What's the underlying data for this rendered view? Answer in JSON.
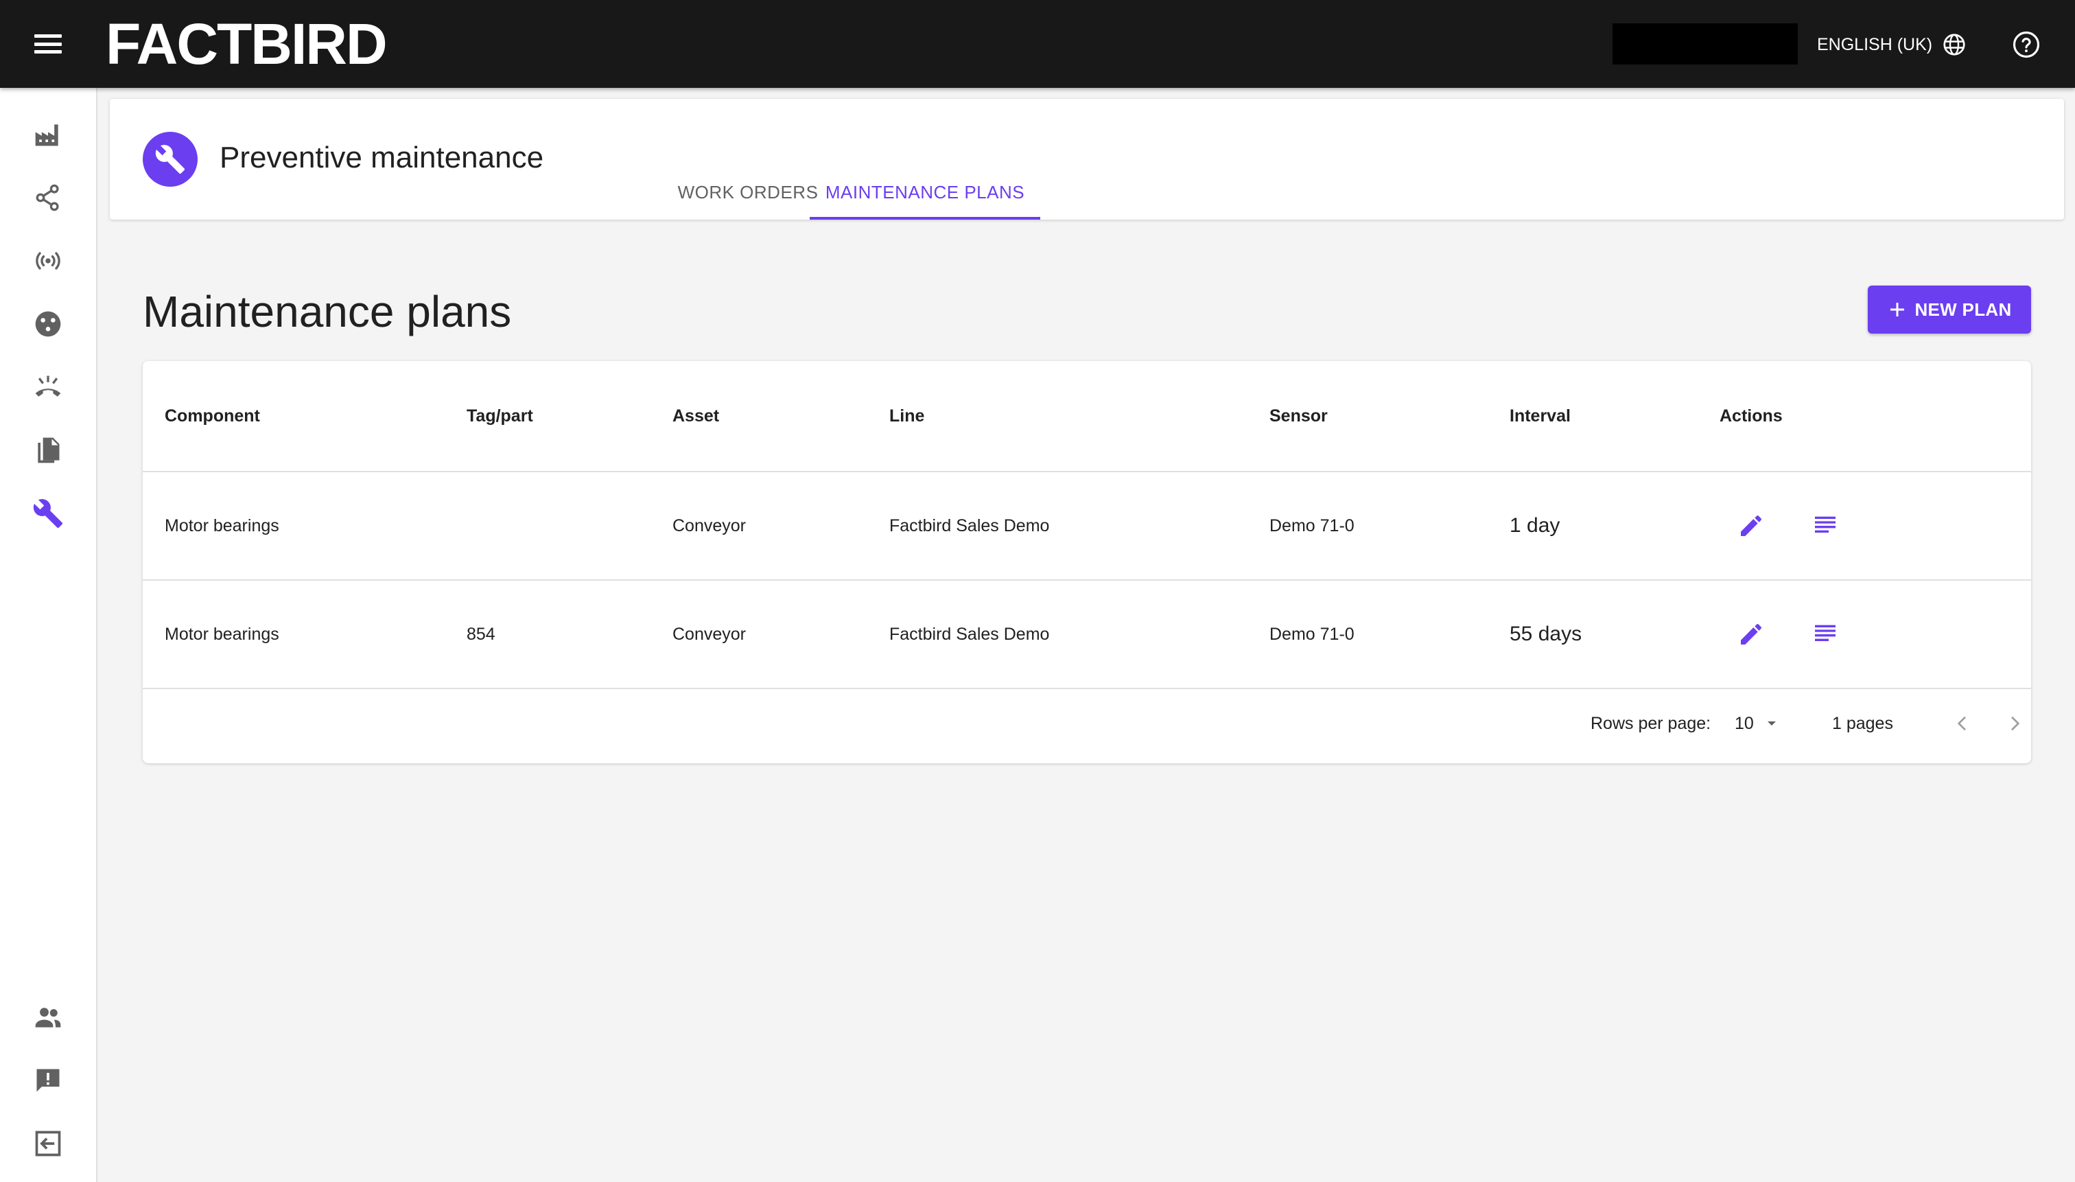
{
  "app": {
    "logo": "FACTBIRD",
    "language": "ENGLISH (UK)"
  },
  "sidebar": {
    "items": [
      {
        "icon": "factory-icon"
      },
      {
        "icon": "share-nodes-icon"
      },
      {
        "icon": "sensor-signal-icon"
      },
      {
        "icon": "palette-icon"
      },
      {
        "icon": "call-end-icon"
      },
      {
        "icon": "documents-icon"
      },
      {
        "icon": "wrench-icon",
        "active": true
      },
      {
        "icon": "people-icon"
      },
      {
        "icon": "feedback-icon"
      },
      {
        "icon": "logout-icon"
      }
    ]
  },
  "header": {
    "title": "Preventive maintenance",
    "tabs": [
      {
        "label": "WORK ORDERS",
        "active": false
      },
      {
        "label": "MAINTENANCE PLANS",
        "active": true
      }
    ]
  },
  "main": {
    "title": "Maintenance plans",
    "new_plan_label": "NEW PLAN"
  },
  "table": {
    "columns": [
      "Component",
      "Tag/part",
      "Asset",
      "Line",
      "Sensor",
      "Interval",
      "Actions"
    ],
    "rows": [
      {
        "component": "Motor bearings",
        "tag": "",
        "asset": "Conveyor",
        "line": "Factbird Sales Demo",
        "sensor": "Demo 71-0",
        "interval": "1 day"
      },
      {
        "component": "Motor bearings",
        "tag": "854",
        "asset": "Conveyor",
        "line": "Factbird Sales Demo",
        "sensor": "Demo 71-0",
        "interval": "55 days"
      }
    ],
    "pagination": {
      "rows_per_page_label": "Rows per page:",
      "rows_per_page": "10",
      "pages": "1 pages"
    }
  },
  "colors": {
    "accent": "#6b3ef0",
    "topbar": "#181818",
    "background": "#f4f4f4"
  }
}
